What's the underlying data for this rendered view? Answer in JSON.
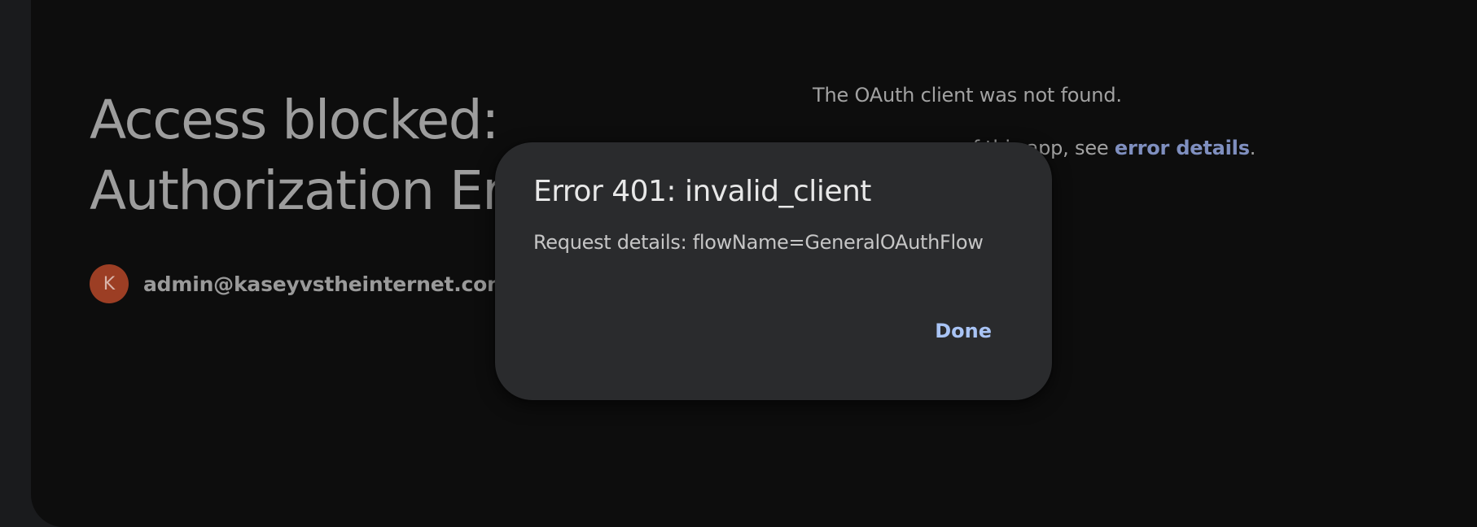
{
  "page": {
    "title_line1": "Access blocked:",
    "title_line2": "Authorization Er",
    "account": {
      "avatar_initial": "K",
      "email": "admin@kaseyvstheinternet.com"
    },
    "info": {
      "line1": "The OAuth client was not found.",
      "line2_prefix": "of this app, see ",
      "line2_link": "error details",
      "line2_suffix": "."
    }
  },
  "dialog": {
    "title": "Error 401: invalid_client",
    "body": "Request details: flowName=GeneralOAuthFlow",
    "done_label": "Done"
  },
  "colors": {
    "avatar": "#9c3e24",
    "link": "#7f8fbf",
    "dialog_bg": "#2a2b2d",
    "done_button": "#a9c4f5"
  }
}
